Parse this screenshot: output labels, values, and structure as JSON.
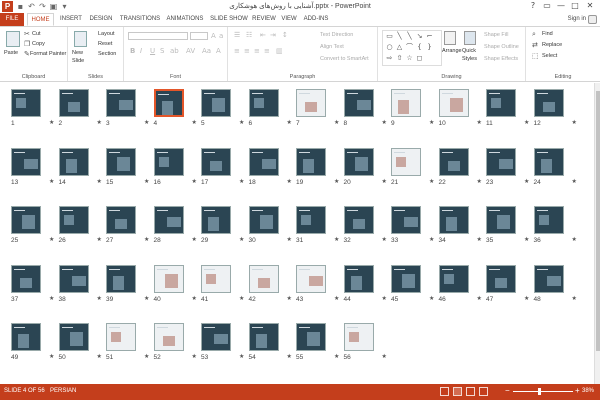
{
  "title_bar": {
    "logo": "P",
    "document_title": "آشنایی با روش‌های هوشکاری.pptx - PowerPoint",
    "window_controls": [
      "?",
      "▭",
      "—",
      "□",
      "✕"
    ]
  },
  "tabs": {
    "file": "FILE",
    "items": [
      "HOME",
      "INSERT",
      "DESIGN",
      "TRANSITIONS",
      "ANIMATIONS",
      "SLIDE SHOW",
      "REVIEW",
      "VIEW",
      "ADD-INS"
    ],
    "active": "HOME",
    "sign_in": "Sign in"
  },
  "ribbon": {
    "clipboard": {
      "label": "Clipboard",
      "paste": "Paste",
      "cut": "Cut",
      "copy": "Copy",
      "format_painter": "Format Painter"
    },
    "slides": {
      "label": "Slides",
      "new_slide": "New Slide",
      "layout": "Layout",
      "reset": "Reset",
      "section": "Section"
    },
    "font": {
      "label": "Font"
    },
    "paragraph": {
      "label": "Paragraph",
      "text_direction": "Text Direction",
      "align_text": "Align Text",
      "convert_smartart": "Convert to SmartArt"
    },
    "drawing": {
      "label": "Drawing",
      "arrange": "Arrange",
      "quick_styles": "Quick Styles",
      "shape_fill": "Shape Fill",
      "shape_outline": "Shape Outline",
      "shape_effects": "Shape Effects"
    },
    "editing": {
      "label": "Editing",
      "find": "Find",
      "replace": "Replace",
      "select": "Select"
    }
  },
  "slides": {
    "selected": 4,
    "items": [
      "1",
      "2",
      "3",
      "4",
      "5",
      "6",
      "7",
      "8",
      "9",
      "10",
      "11",
      "12",
      "13",
      "14",
      "15",
      "16",
      "17",
      "18",
      "19",
      "20",
      "21",
      "22",
      "23",
      "24",
      "25",
      "26",
      "27",
      "28",
      "29",
      "30",
      "31",
      "32",
      "33",
      "34",
      "35",
      "36",
      "37",
      "38",
      "39",
      "40",
      "41",
      "42",
      "43",
      "44",
      "45",
      "46",
      "47",
      "48",
      "49",
      "50",
      "51",
      "52",
      "53",
      "54",
      "55",
      "56"
    ],
    "star": "★"
  },
  "status": {
    "slide_info": "SLIDE 4 OF 56",
    "language": "PERSIAN",
    "zoom": "38%",
    "zoom_minus": "−",
    "zoom_plus": "+"
  },
  "colors": {
    "accent": "#c43e1c",
    "selection": "#e3562a",
    "slide_bg": "#2b4553"
  }
}
